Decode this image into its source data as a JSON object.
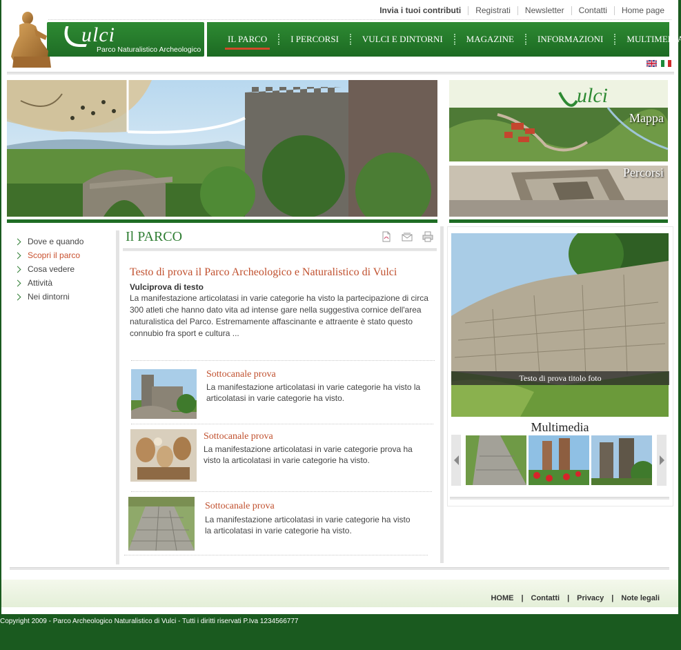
{
  "top_links": {
    "submit": "Invia i tuoi contributi",
    "register": "Registrati",
    "newsletter": "Newsletter",
    "contacts": "Contatti",
    "home": "Home page"
  },
  "logo": {
    "word": "ulci",
    "subtitle": "Parco Naturalistico Archeologico"
  },
  "nav": [
    {
      "label": "IL PARCO",
      "active": true
    },
    {
      "label": "I PERCORSI"
    },
    {
      "label": "VULCI E DINTORNI"
    },
    {
      "label": "MAGAZINE"
    },
    {
      "label": "INFORMAZIONI"
    },
    {
      "label": "MULTIMEDIA"
    }
  ],
  "promos": {
    "map_label": "Mappa",
    "routes_label": "Percorsi",
    "map_logo": "ulci"
  },
  "left_menu": [
    {
      "label": "Dove e quando"
    },
    {
      "label": "Scopri il parco",
      "active": true
    },
    {
      "label": "Cosa vedere"
    },
    {
      "label": "Attività"
    },
    {
      "label": "Nei dintorni"
    }
  ],
  "section_title": "Il PARCO",
  "article": {
    "title": "Testo di prova  il Parco Archeologico e Naturalistico di Vulci",
    "subtitle": "Vulciprova di testo",
    "body": "La manifestazione articolatasi in varie categorie ha visto la partecipazione di circa 300 atleti che hanno dato vita ad intense gare nella suggestiva cornice dell'area naturalistica del Parco. Estremamente affascinante e attraente è stato questo connubio fra sport e cultura ..."
  },
  "sub_items": [
    {
      "title": "Sottocanale prova",
      "body": "La manifestazione articolatasi in varie categorie ha visto la articolatasi in varie categorie ha visto."
    },
    {
      "title": "Sottocanale prova",
      "body": "La manifestazione articolatasi in varie categorie prova ha visto la  articolatasi in varie categorie ha visto."
    },
    {
      "title": "Sottocanale prova",
      "body": "La manifestazione articolatasi in varie categorie ha visto la articolatasi in varie categorie ha visto."
    }
  ],
  "multimedia": {
    "caption": "Testo di prova titolo foto",
    "title": "Multimedia"
  },
  "footer": {
    "links": [
      "HOME",
      "Contatti",
      "Privacy",
      "Note legali"
    ],
    "copyright": "Copyright 2009 - Parco Archeologico Naturalistico di Vulci - Tutti i diritti riservati P.Iva 1234566777"
  },
  "colors": {
    "brand_green": "#1f6d25",
    "accent_red": "#c0502e",
    "footer_bg": "#1a5a1f"
  }
}
